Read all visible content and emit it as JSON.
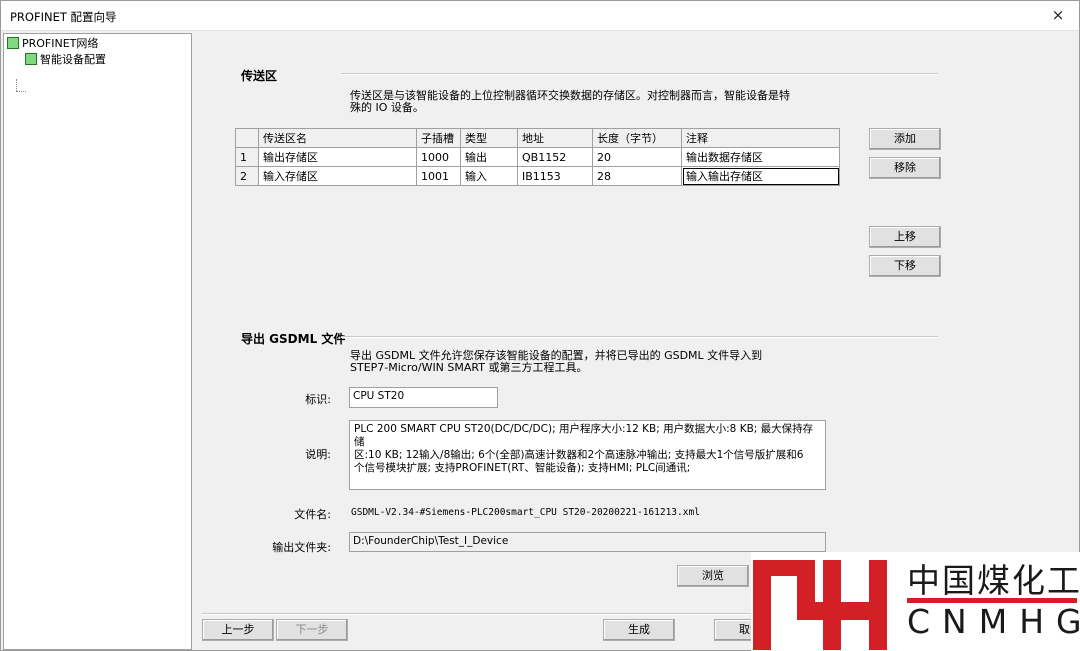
{
  "window": {
    "title": "PROFINET 配置向导",
    "close_icon": "×"
  },
  "tree": {
    "root": {
      "label": "PROFINET网络"
    },
    "child": {
      "label": "智能设备配置"
    }
  },
  "transfer": {
    "title": "传送区",
    "desc_line1": "传送区是与该智能设备的上位控制器循环交换数据的存储区。对控制器而言，智能设备是特",
    "desc_line2": "殊的 IO 设备。",
    "columns": [
      "传送区名",
      "子插槽",
      "类型",
      "地址",
      "长度（字节）",
      "注释"
    ],
    "rows": [
      {
        "num": "1",
        "name": "输出存储区",
        "slot": "1000",
        "type": "输出",
        "addr": "QB1152",
        "len": "20",
        "note": "输出数据存储区"
      },
      {
        "num": "2",
        "name": "输入存储区",
        "slot": "1001",
        "type": "输入",
        "addr": "IB1153",
        "len": "28",
        "note": "输入输出存储区"
      }
    ],
    "buttons": {
      "add": "添加",
      "remove": "移除",
      "up": "上移",
      "down": "下移"
    }
  },
  "gsdml": {
    "title": "导出 GSDML 文件",
    "desc_line1": "导出 GSDML 文件允许您保存该智能设备的配置，并将已导出的 GSDML 文件导入到",
    "desc_line2": "STEP7-Micro/WIN SMART 或第三方工程工具。",
    "id_label": "标识:",
    "id_value": "CPU ST20",
    "desc_label": "说明:",
    "description_l1": "PLC 200 SMART CPU ST20(DC/DC/DC); 用户程序大小:12 KB; 用户数据大小:8 KB; 最大保持存储",
    "description_l2": "区:10 KB; 12输入/8输出; 6个(全部)高速计数器和2个高速脉冲输出; 支持最大1个信号版扩展和6",
    "description_l3": "个信号模块扩展; 支持PROFINET(RT、智能设备); 支持HMI; PLC间通讯;",
    "filename_label": "文件名:",
    "filename_value": "GSDML-V2.34-#Siemens-PLC200smart_CPU ST20-20200221-161213.xml",
    "folder_label": "输出文件夹:",
    "folder_value": "D:\\FounderChip\\Test_I_Device",
    "browse_label": "浏览"
  },
  "footer": {
    "prev": "上一步",
    "next": "下一步",
    "generate": "生成",
    "cancel": "取消"
  },
  "watermark": {
    "cn": "中国煤化工",
    "en": "CNMHG",
    "color": "#d31f26"
  }
}
